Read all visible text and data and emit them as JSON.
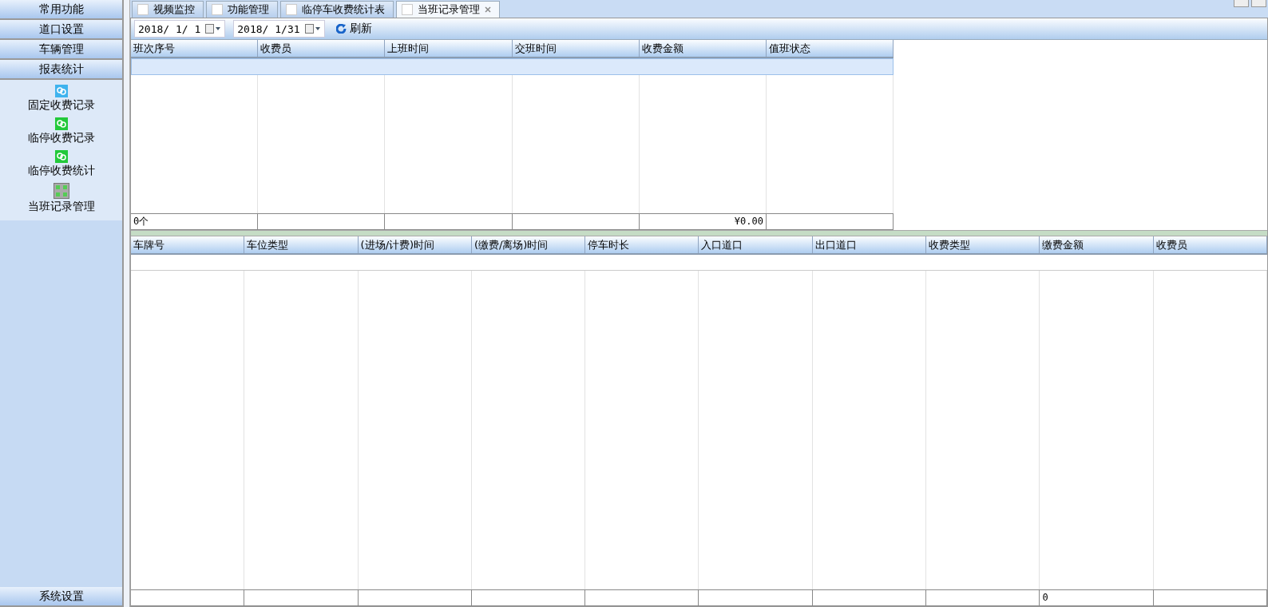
{
  "sidebar": {
    "sections": [
      {
        "label": "常用功能"
      },
      {
        "label": "道口设置"
      },
      {
        "label": "车辆管理"
      },
      {
        "label": "报表统计",
        "items": [
          {
            "label": "固定收费记录"
          },
          {
            "label": "临停收费记录"
          },
          {
            "label": "临停收费统计"
          },
          {
            "label": "当班记录管理"
          }
        ]
      }
    ],
    "bottom_section": {
      "label": "系统设置"
    }
  },
  "tabs": [
    {
      "label": "视频监控",
      "selected": false
    },
    {
      "label": "功能管理",
      "selected": false
    },
    {
      "label": "临停车收费统计表",
      "selected": false
    },
    {
      "label": "当班记录管理",
      "selected": true
    }
  ],
  "toolbar": {
    "date_from": "2018/ 1/ 1",
    "date_to": "2018/ 1/31",
    "refresh": "刷新"
  },
  "shift_table": {
    "columns": [
      "班次序号",
      "收费员",
      "上班时间",
      "交班时间",
      "收费金额",
      "值班状态"
    ],
    "rows": [
      {
        "selected": true
      }
    ],
    "footer": {
      "count": "0个",
      "amount": "¥0.00"
    }
  },
  "record_table": {
    "columns": [
      "车牌号",
      "车位类型",
      "(进场/计费)时间",
      "(缴费/离场)时间",
      "停车时长",
      "入口道口",
      "出口道口",
      "收费类型",
      "缴费金额",
      "收费员"
    ],
    "rows": [
      {
        "selected": false
      }
    ],
    "footer": {
      "amount": "0"
    }
  }
}
